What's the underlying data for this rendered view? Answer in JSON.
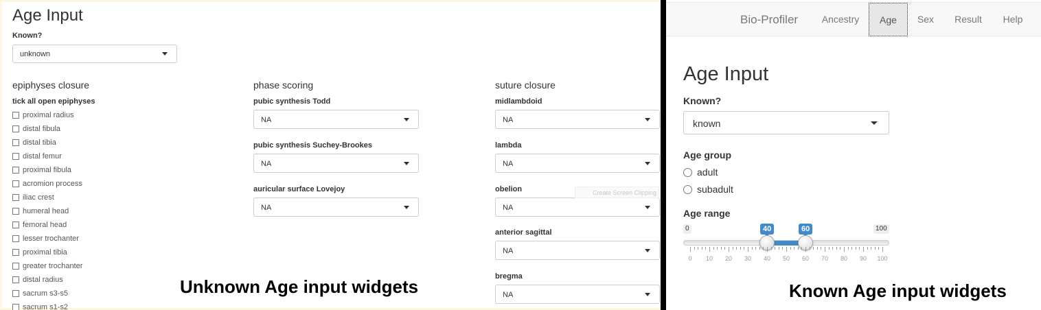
{
  "left": {
    "title": "Age Input",
    "known_label": "Known?",
    "known_value": "unknown",
    "epiphyses": {
      "heading": "epiphyses closure",
      "tick_label": "tick all open epiphyses",
      "items": [
        "proximal radius",
        "distal fibula",
        "distal tibia",
        "distal femur",
        "proximal fibula",
        "acromion process",
        "iliac crest",
        "humeral head",
        "femoral head",
        "lesser trochanter",
        "proximal tibia",
        "greater trochanter",
        "distal radius",
        "sacrum s3-s5",
        "sacrum s1-s2"
      ]
    },
    "phase": {
      "heading": "phase scoring",
      "fields": [
        {
          "label": "pubic synthesis Todd",
          "value": "NA"
        },
        {
          "label": "pubic synthesis Suchey-Brookes",
          "value": "NA"
        },
        {
          "label": "auricular surface Lovejoy",
          "value": "NA"
        }
      ]
    },
    "suture": {
      "heading": "suture closure",
      "fields": [
        {
          "label": "midlambdoid",
          "value": "NA"
        },
        {
          "label": "lambda",
          "value": "NA"
        },
        {
          "label": "obelion",
          "value": "NA"
        },
        {
          "label": "anterior sagittal",
          "value": "NA"
        },
        {
          "label": "bregma",
          "value": "NA"
        }
      ]
    },
    "ghost_tooltip": "Create Screen Clipping",
    "caption": "Unknown Age input widgets"
  },
  "right": {
    "navbar": {
      "brand": "Bio-Profiler",
      "items": [
        "Ancestry",
        "Age",
        "Sex",
        "Result",
        "Help"
      ],
      "active": "Age"
    },
    "title": "Age Input",
    "known_label": "Known?",
    "known_value": "known",
    "age_group": {
      "label": "Age group",
      "options": [
        "adult",
        "subadult"
      ]
    },
    "age_range": {
      "label": "Age range",
      "min": "0",
      "max": "100",
      "from": "40",
      "to": "60",
      "tick_labels": [
        "0",
        "10",
        "20",
        "30",
        "40",
        "50",
        "60",
        "70",
        "80",
        "90",
        "100"
      ]
    },
    "caption": "Known Age input widgets"
  }
}
